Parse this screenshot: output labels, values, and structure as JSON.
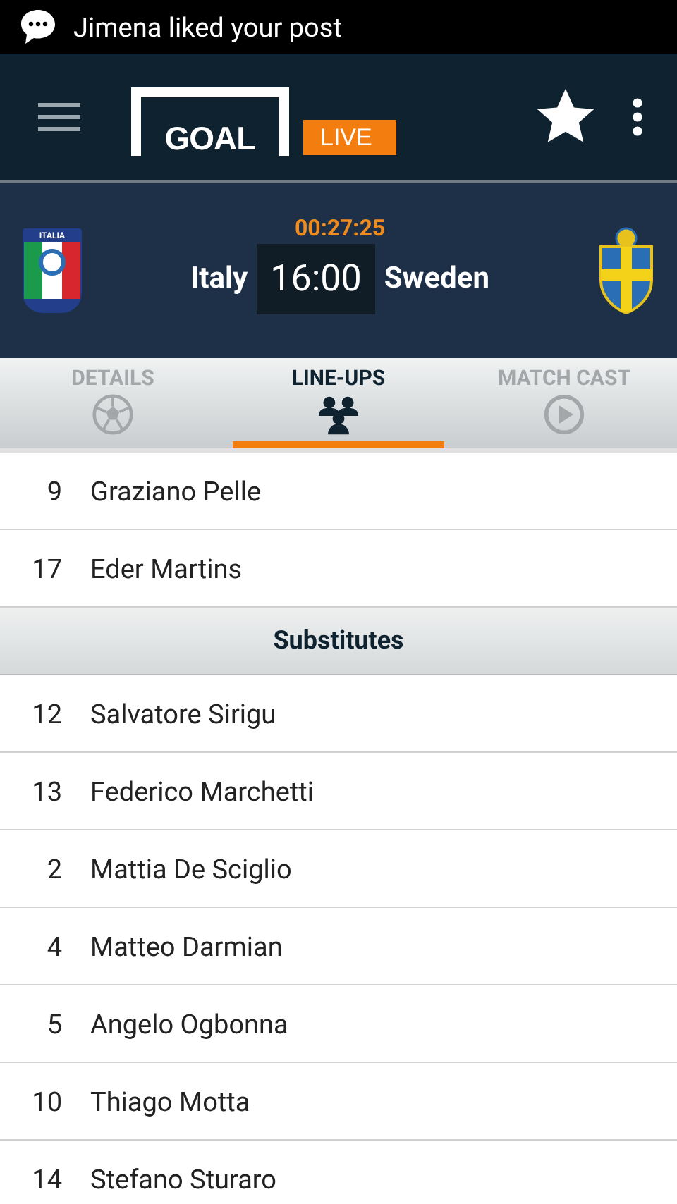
{
  "notification": {
    "text": "Jimena liked your post"
  },
  "app_bar": {
    "logo_text": "GOAL",
    "live_badge": "LIVE"
  },
  "match": {
    "clock": "00:27:25",
    "home_team": "Italy",
    "kickoff": "16:00",
    "away_team": "Sweden",
    "home_crest_text": "ITALIA"
  },
  "tabs": [
    {
      "label": "DETAILS",
      "selected": false
    },
    {
      "label": "LINE-UPS",
      "selected": true
    },
    {
      "label": "MATCH CAST",
      "selected": false
    }
  ],
  "rows": [
    {
      "kind": "player",
      "number": "9",
      "name": "Graziano Pelle"
    },
    {
      "kind": "player",
      "number": "17",
      "name": "Eder Martins"
    },
    {
      "kind": "section",
      "name": "Substitutes"
    },
    {
      "kind": "player",
      "number": "12",
      "name": "Salvatore Sirigu"
    },
    {
      "kind": "player",
      "number": "13",
      "name": "Federico Marchetti"
    },
    {
      "kind": "player",
      "number": "2",
      "name": "Mattia De Sciglio"
    },
    {
      "kind": "player",
      "number": "4",
      "name": "Matteo Darmian"
    },
    {
      "kind": "player",
      "number": "5",
      "name": "Angelo Ogbonna"
    },
    {
      "kind": "player",
      "number": "10",
      "name": "Thiago Motta"
    },
    {
      "kind": "player",
      "number": "14",
      "name": "Stefano Sturaro"
    }
  ]
}
